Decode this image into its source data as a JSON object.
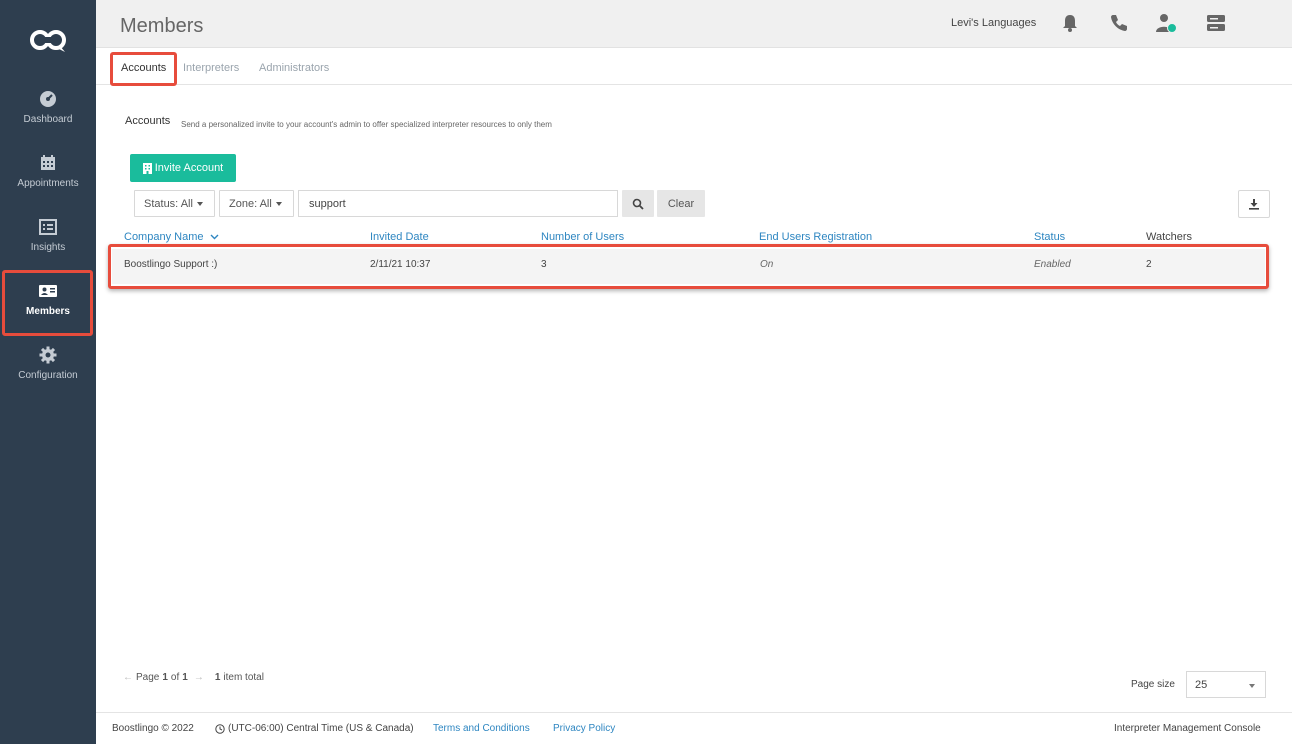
{
  "sidebar": {
    "logo_icon": "boostlingo-logo-icon",
    "items": [
      {
        "label": "Dashboard",
        "icon": "dashboard-gauge-icon"
      },
      {
        "label": "Appointments",
        "icon": "calendar-icon"
      },
      {
        "label": "Insights",
        "icon": "list-icon"
      },
      {
        "label": "Members",
        "icon": "id-card-icon",
        "active": true
      },
      {
        "label": "Configuration",
        "icon": "gear-icon"
      }
    ]
  },
  "header": {
    "title": "Members",
    "org_name": "Levi's Languages",
    "icons": [
      "bell-icon",
      "phone-icon",
      "user-status-icon",
      "server-icon"
    ],
    "status_color": "#1abc9c"
  },
  "tabs": [
    {
      "label": "Accounts",
      "active": true
    },
    {
      "label": "Interpreters"
    },
    {
      "label": "Administrators"
    }
  ],
  "section": {
    "title": "Accounts",
    "description": "Send a personalized invite to your account's admin to offer specialized interpreter resources to only them"
  },
  "toolbar": {
    "invite_label": "Invite Account",
    "status_filter": "Status: All",
    "zone_filter": "Zone: All",
    "search_value": "support",
    "clear_label": "Clear"
  },
  "table": {
    "columns": [
      "Company Name",
      "Invited Date",
      "Number of Users",
      "End Users Registration",
      "Status",
      "Watchers"
    ],
    "rows": [
      {
        "company": "Boostlingo Support :)",
        "invited": "2/11/21 10:37",
        "users": "3",
        "registration": "On",
        "status": "Enabled",
        "watchers": "2"
      }
    ]
  },
  "pagination": {
    "page_prefix": "Page",
    "page": "1",
    "of_label": "of",
    "total_pages": "1",
    "total_count": "1",
    "total_label": "item total",
    "page_size_label": "Page size",
    "page_size": "25"
  },
  "footer": {
    "copyright": "Boostlingo © 2022",
    "timezone": "(UTC-06:00) Central Time (US & Canada)",
    "terms": "Terms and Conditions",
    "privacy": "Privacy Policy",
    "console": "Interpreter Management Console"
  },
  "colors": {
    "sidebar": "#2e3e4f",
    "accent": "#1abc9c",
    "link": "#2e86c1",
    "highlight": "#e74c3c"
  }
}
